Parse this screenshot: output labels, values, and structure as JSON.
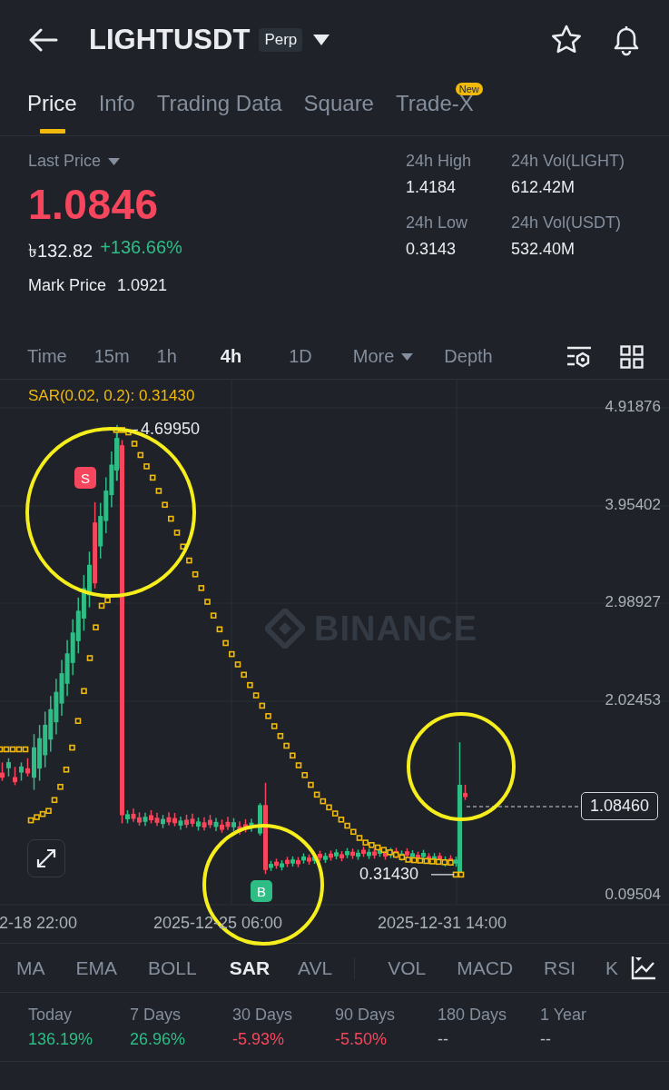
{
  "header": {
    "title": "LIGHTUSDT",
    "badge": "Perp"
  },
  "tabs": [
    {
      "label": "Price",
      "selected": true
    },
    {
      "label": "Info",
      "selected": false
    },
    {
      "label": "Trading Data",
      "selected": false
    },
    {
      "label": "Square",
      "selected": false
    },
    {
      "label": "Trade-X",
      "selected": false,
      "badge": "New"
    }
  ],
  "price": {
    "label": "Last Price",
    "last": "1.0846",
    "fiat": "৳132.82",
    "change": "+136.66%",
    "mark_label": "Mark Price",
    "mark": "1.0921"
  },
  "stats": [
    {
      "label": "24h High",
      "value": "1.4184"
    },
    {
      "label": "24h Vol(LIGHT)",
      "value": "612.42M"
    },
    {
      "label": "24h Low",
      "value": "0.3143"
    },
    {
      "label": "24h Vol(USDT)",
      "value": "532.40M"
    }
  ],
  "intervals": [
    {
      "label": "Time",
      "selected": false,
      "kind": "plain"
    },
    {
      "label": "15m",
      "selected": false,
      "kind": "plain"
    },
    {
      "label": "1h",
      "selected": false,
      "kind": "plain"
    },
    {
      "label": "4h",
      "selected": true,
      "kind": "plain"
    },
    {
      "label": "1D",
      "selected": false,
      "kind": "plain"
    },
    {
      "label": "More",
      "selected": false,
      "kind": "dropdown"
    },
    {
      "label": "Depth",
      "selected": false,
      "kind": "plain"
    }
  ],
  "chart": {
    "indicator": "SAR(0.02, 0.2): 0.31430",
    "watermark": "BINANCE",
    "y_labels": [
      "4.91876",
      "3.95402",
      "2.98927",
      "2.02453",
      "0.09504"
    ],
    "x_labels": [
      "2-18 22:00",
      "2025-12-25 06:00",
      "2025-12-31 14:00"
    ],
    "high_label": "4.69950",
    "low_label": "0.31430",
    "current_price": "1.08460",
    "signals": [
      {
        "label": "S",
        "kind": "sell"
      },
      {
        "label": "B",
        "kind": "buy"
      }
    ]
  },
  "indicators": [
    {
      "label": "MA",
      "selected": false
    },
    {
      "label": "EMA",
      "selected": false
    },
    {
      "label": "BOLL",
      "selected": false
    },
    {
      "label": "SAR",
      "selected": true
    },
    {
      "label": "AVL",
      "selected": false
    },
    {
      "label": "VOL",
      "selected": false
    },
    {
      "label": "MACD",
      "selected": false
    },
    {
      "label": "RSI",
      "selected": false
    },
    {
      "label": "K",
      "selected": false
    }
  ],
  "performance": [
    {
      "label": "Today",
      "value": "136.19%",
      "color": "#2ebd85"
    },
    {
      "label": "7 Days",
      "value": "26.96%",
      "color": "#2ebd85"
    },
    {
      "label": "30 Days",
      "value": "-5.93%",
      "color": "#f6465d"
    },
    {
      "label": "90 Days",
      "value": "-5.50%",
      "color": "#f6465d"
    },
    {
      "label": "180 Days",
      "value": "--",
      "color": "#b7bdc6"
    },
    {
      "label": "1 Year",
      "value": "--",
      "color": "#b7bdc6"
    }
  ]
}
